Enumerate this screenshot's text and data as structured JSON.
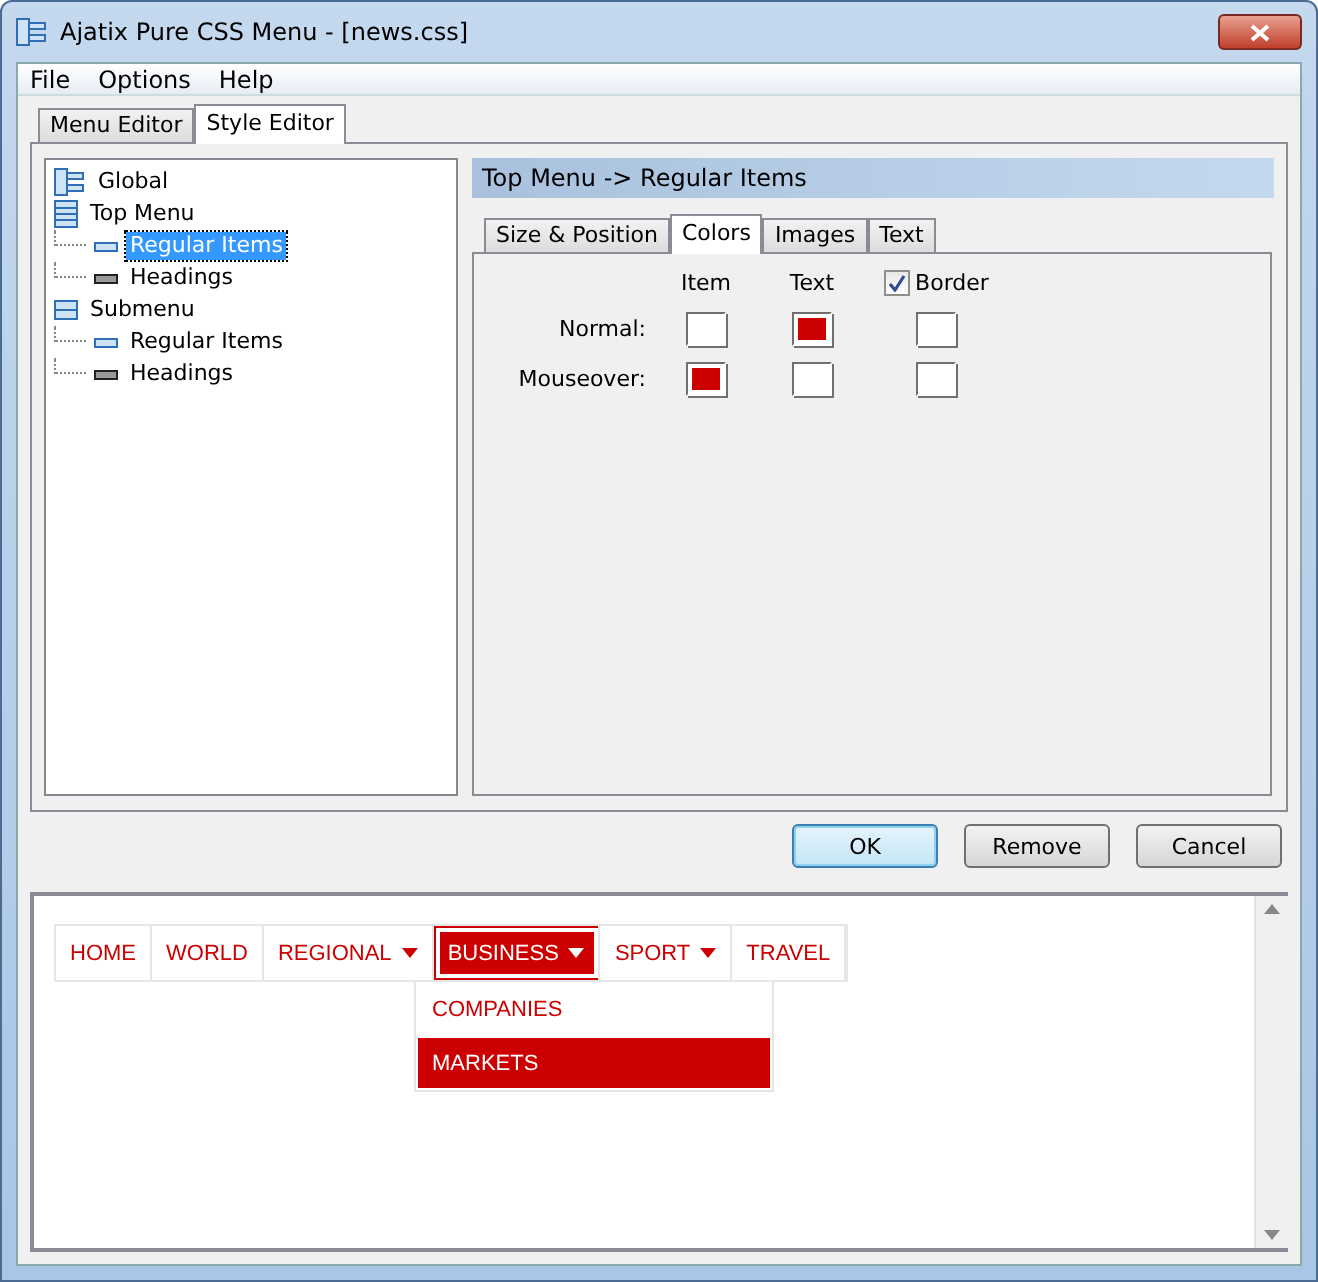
{
  "window": {
    "title": "Ajatix Pure CSS Menu - [news.css]"
  },
  "menu_bar": [
    "File",
    "Options",
    "Help"
  ],
  "tabs": [
    {
      "label": "Menu Editor",
      "selected": false
    },
    {
      "label": "Style Editor",
      "selected": true
    }
  ],
  "tree": [
    {
      "label": "Global",
      "kind": "global",
      "selected": false
    },
    {
      "label": "Top Menu",
      "kind": "menu",
      "selected": false,
      "children": [
        {
          "label": "Regular Items",
          "kind": "regular",
          "selected": true
        },
        {
          "label": "Headings",
          "kind": "heading",
          "selected": false
        }
      ]
    },
    {
      "label": "Submenu",
      "kind": "submenu",
      "selected": false,
      "children": [
        {
          "label": "Regular Items",
          "kind": "regular",
          "selected": false
        },
        {
          "label": "Headings",
          "kind": "heading",
          "selected": false
        }
      ]
    }
  ],
  "section_title": "Top Menu -> Regular Items",
  "sub_tabs": [
    {
      "label": "Size & Position",
      "selected": false
    },
    {
      "label": "Colors",
      "selected": true
    },
    {
      "label": "Images",
      "selected": false
    },
    {
      "label": "Text",
      "selected": false
    }
  ],
  "colors": {
    "columns": [
      "Item",
      "Text",
      "Border"
    ],
    "border_checked": true,
    "rows": [
      {
        "label": "Normal:",
        "swatches": [
          {
            "color": "#ffffff"
          },
          {
            "color": "#cc0000"
          },
          {
            "color": "#ffffff"
          }
        ]
      },
      {
        "label": "Mouseover:",
        "swatches": [
          {
            "color": "#cc0000"
          },
          {
            "color": "#ffffff"
          },
          {
            "color": "#ffffff"
          }
        ]
      }
    ]
  },
  "buttons": [
    {
      "label": "OK",
      "default": true
    },
    {
      "label": "Remove",
      "default": false
    },
    {
      "label": "Cancel",
      "default": false
    }
  ],
  "preview": {
    "nav": [
      {
        "label": "HOME",
        "dropdown": false,
        "selected": false
      },
      {
        "label": "WORLD",
        "dropdown": false,
        "selected": false
      },
      {
        "label": "REGIONAL",
        "dropdown": true,
        "selected": false
      },
      {
        "label": "BUSINESS",
        "dropdown": true,
        "selected": true
      },
      {
        "label": "SPORT",
        "dropdown": true,
        "selected": false
      },
      {
        "label": "TRAVEL",
        "dropdown": false,
        "selected": false
      }
    ],
    "submenu": [
      {
        "label": "COMPANIES",
        "selected": false
      },
      {
        "label": "MARKETS",
        "selected": true
      }
    ]
  }
}
